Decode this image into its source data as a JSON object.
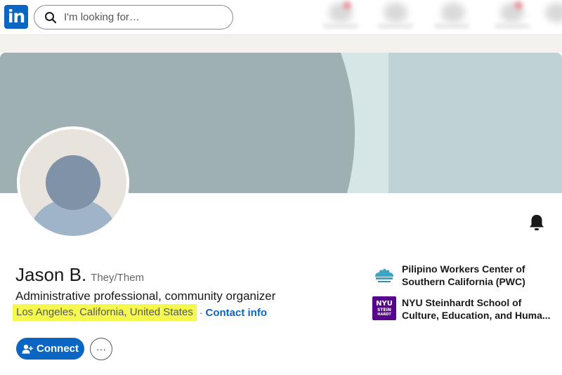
{
  "nav": {
    "logo_text": "in",
    "search_placeholder": "I'm looking for…"
  },
  "profile": {
    "name": "Jason B.",
    "pronouns": "They/Them",
    "headline": "Administrative professional, community organizer",
    "location": "Los Angeles, California, United States",
    "separator": "·",
    "contact_label": "Contact info",
    "connect_label": "Connect",
    "more_label": "···"
  },
  "orgs": [
    {
      "name": "Pilipino Workers Center of Southern California (PWC)"
    },
    {
      "name": "NYU Steinhardt School of Culture, Education, and Huma...",
      "logo_lines": [
        "NYU",
        "STEIN",
        "HARDT"
      ]
    }
  ],
  "colors": {
    "brand": "#0a66c2",
    "highlight": "#f5f94d",
    "banner_left": "#9eb0b2",
    "banner_mid": "#d6e5e5",
    "banner_right": "#bfd3d6",
    "nyu_purple": "#57068c"
  }
}
